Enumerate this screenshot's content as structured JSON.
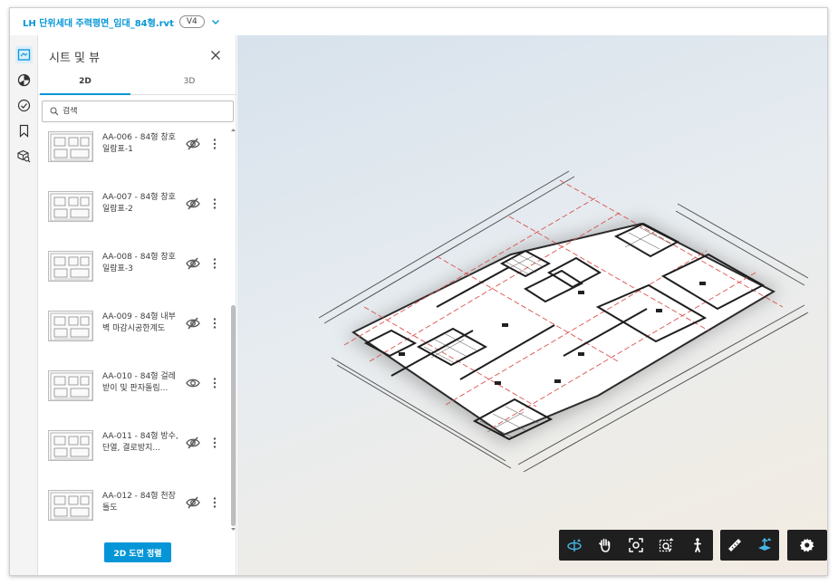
{
  "header": {
    "file_title": "LH 단위세대 주력평면_임대_84형.rvt",
    "version": "V4"
  },
  "panel": {
    "title": "시트 및 뷰",
    "tabs": [
      {
        "label": "2D",
        "active": true
      },
      {
        "label": "3D",
        "active": false
      }
    ],
    "search": {
      "placeholder": "검색",
      "value": ""
    },
    "sheets": [
      {
        "name": "AA-006 - 84형 창호일람표-1",
        "visible": false
      },
      {
        "name": "AA-007 - 84형 창호일람표-2",
        "visible": false
      },
      {
        "name": "AA-008 - 84형 창호일람표-3",
        "visible": false
      },
      {
        "name": "AA-009 - 84형 내부벽 마감시공한계도",
        "visible": false
      },
      {
        "name": "AA-010 - 84형 걸레받이 및 판자돌림...",
        "visible": true
      },
      {
        "name": "AA-011 - 84형 방수, 단열, 결로방지...",
        "visible": false
      },
      {
        "name": "AA-012 - 84형 천장틀도",
        "visible": false
      }
    ],
    "scroll_position": 0.44,
    "sort_button_label": "2D 도면 정렬"
  },
  "sidebar_tools": [
    {
      "name": "sheets-views-icon",
      "active": true
    },
    {
      "name": "model-browser-icon",
      "active": false
    },
    {
      "name": "issues-icon",
      "active": false
    },
    {
      "name": "bookmark-icon",
      "active": false
    },
    {
      "name": "model-search-icon",
      "active": false
    }
  ],
  "viewer_toolbar": {
    "navigation": [
      "orbit-icon",
      "pan-icon",
      "fit-view-icon",
      "zoom-window-icon",
      "walk-icon"
    ],
    "tools": [
      "measure-icon",
      "section-icon"
    ],
    "settings": [
      "settings-icon"
    ]
  },
  "colors": {
    "accent": "#0696d7",
    "toolbar_bg": "#1f1f1f",
    "toolbar_highlight": "#46b4e6",
    "grid_red": "#d9534f"
  }
}
